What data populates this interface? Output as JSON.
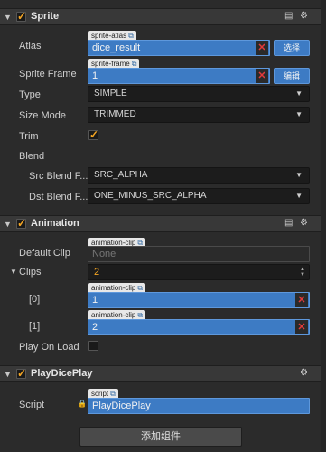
{
  "sprite": {
    "title": "Sprite",
    "atlas_label": "Atlas",
    "atlas_tag": "sprite-atlas",
    "atlas_value": "dice_result",
    "atlas_btn": "选择",
    "frame_label": "Sprite Frame",
    "frame_tag": "sprite-frame",
    "frame_value": "1",
    "frame_btn": "编辑",
    "type_label": "Type",
    "type_value": "SIMPLE",
    "size_label": "Size Mode",
    "size_value": "TRIMMED",
    "trim_label": "Trim",
    "trim_checked": true,
    "blend_label": "Blend",
    "src_label": "Src Blend F...",
    "src_value": "SRC_ALPHA",
    "dst_label": "Dst Blend F...",
    "dst_value": "ONE_MINUS_SRC_ALPHA"
  },
  "animation": {
    "title": "Animation",
    "default_label": "Default Clip",
    "default_tag": "animation-clip",
    "default_value": "None",
    "clips_label": "Clips",
    "clips_count": "2",
    "clip0_label": "[0]",
    "clip0_tag": "animation-clip",
    "clip0_value": "1",
    "clip1_label": "[1]",
    "clip1_tag": "animation-clip",
    "clip1_value": "2",
    "playonload_label": "Play On Load",
    "playonload_checked": false
  },
  "playdice": {
    "title": "PlayDicePlay",
    "script_label": "Script",
    "script_tag": "script",
    "script_value": "PlayDicePlay"
  },
  "icons": {
    "collapse": "▼",
    "expand": "▶",
    "check": "✓",
    "remove": "✕",
    "link": "⧉",
    "gear": "⚙",
    "book": "▤",
    "lock": "🔒"
  },
  "add_component_label": "添加组件"
}
